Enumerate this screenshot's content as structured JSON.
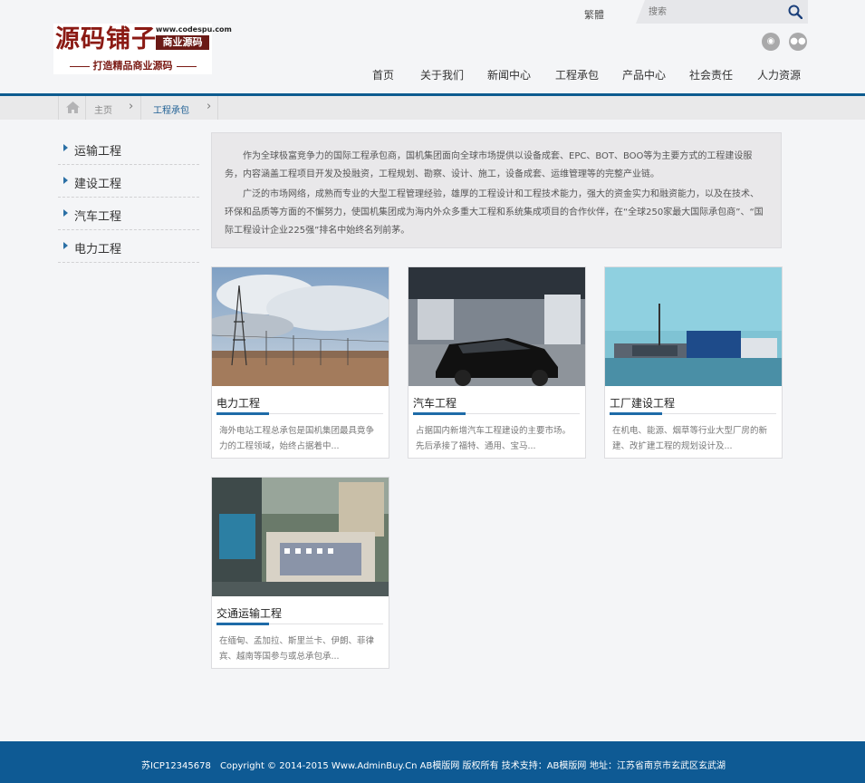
{
  "logo": {
    "main": "源码铺子",
    "url": "www.codespu.com",
    "badge": "商业源码",
    "slogan": "打造精品商业源码"
  },
  "header": {
    "lang": "繁體",
    "search_placeholder": "搜索",
    "social": [
      "weibo-icon",
      "wechat-icon"
    ]
  },
  "nav": [
    "首页",
    "关于我们",
    "新闻中心",
    "工程承包",
    "产品中心",
    "社会责任",
    "人力资源"
  ],
  "breadcrumb": {
    "home": "主页",
    "current": "工程承包"
  },
  "sidebar": [
    "运输工程",
    "建设工程",
    "汽车工程",
    "电力工程"
  ],
  "intro": {
    "p1": "作为全球极富竞争力的国际工程承包商，国机集团面向全球市场提供以设备成套、EPC、BOT、BOO等为主要方式的工程建设服务，内容涵盖工程项目开发及投融资，工程规划、勘察、设计、施工，设备成套、运维管理等的完整产业链。",
    "p2": "广泛的市场网络，成熟而专业的大型工程管理经验，雄厚的工程设计和工程技术能力，强大的资金实力和融资能力，以及在技术、环保和品质等方面的不懈努力，使国机集团成为海内外众多重大工程和系统集成项目的合作伙伴，在“全球250家最大国际承包商”、“国际工程设计企业225强”排名中始终名列前茅。"
  },
  "cards": [
    {
      "title": "电力工程",
      "desc": "海外电站工程总承包是国机集团最具竟争力的工程领域，始终占据着中..."
    },
    {
      "title": "汽车工程",
      "desc": "占据国内新增汽车工程建设的主要市场。先后承接了福特、通用、宝马..."
    },
    {
      "title": "工厂建设工程",
      "desc": "在机电、能源、烟草等行业大型厂房的新建、改扩建工程的规划设计及..."
    },
    {
      "title": "交通运输工程",
      "desc": "在缅甸、孟加拉、斯里兰卡、伊朗、菲律宾、越南等国参与或总承包承..."
    }
  ],
  "footer": {
    "icp": "苏ICP12345678",
    "copyright": "Copyright © 2014-2015 Www.AdminBuy.Cn AB模版网 版权所有 技术支持：AB模版网",
    "address": "地址：江苏省南京市玄武区玄武湖"
  },
  "colors": {
    "primary": "#0e5a94",
    "accent": "#1e6ba8",
    "logo_red": "#8b1a14"
  }
}
